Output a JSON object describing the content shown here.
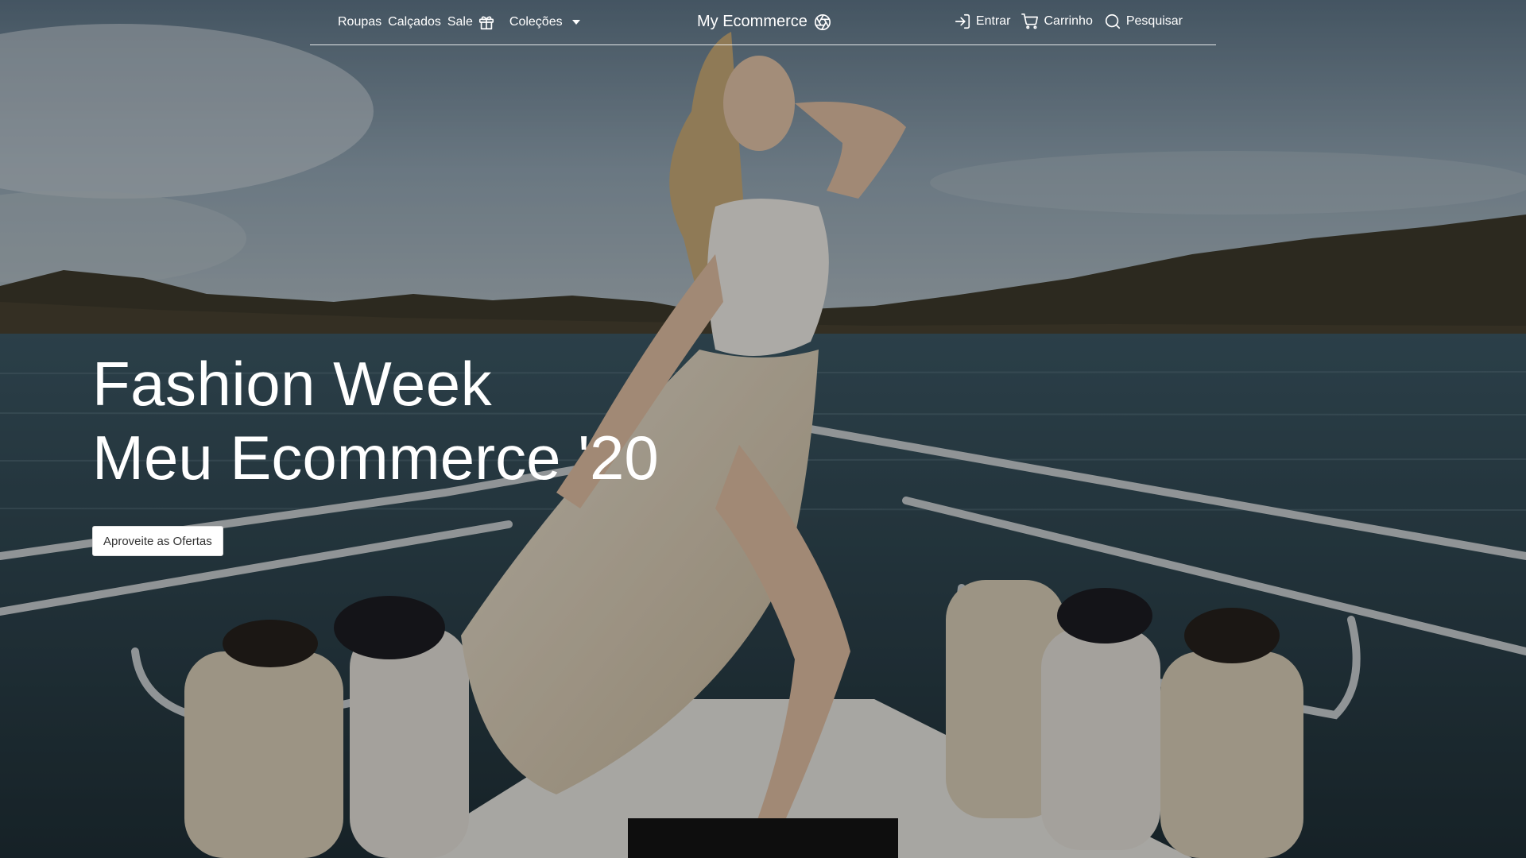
{
  "nav": {
    "left_items": [
      {
        "label": "Roupas"
      },
      {
        "label": "Calçados"
      },
      {
        "label": "Sale",
        "icon": "gift-icon"
      },
      {
        "label": "Coleções",
        "dropdown": true
      }
    ],
    "brand": {
      "label": "My Ecommerce",
      "icon": "aperture-icon"
    },
    "right_items": [
      {
        "label": "Entrar",
        "icon": "login-icon"
      },
      {
        "label": "Carrinho",
        "icon": "cart-icon"
      },
      {
        "label": "Pesquisar",
        "icon": "search-icon"
      }
    ]
  },
  "hero": {
    "line1": "Fashion Week",
    "line2": "Meu Ecommerce '20",
    "cta_label": "Aproveite as Ofertas"
  },
  "colors": {
    "text": "#ffffff",
    "button_bg": "#ffffff",
    "button_text": "#333333"
  }
}
